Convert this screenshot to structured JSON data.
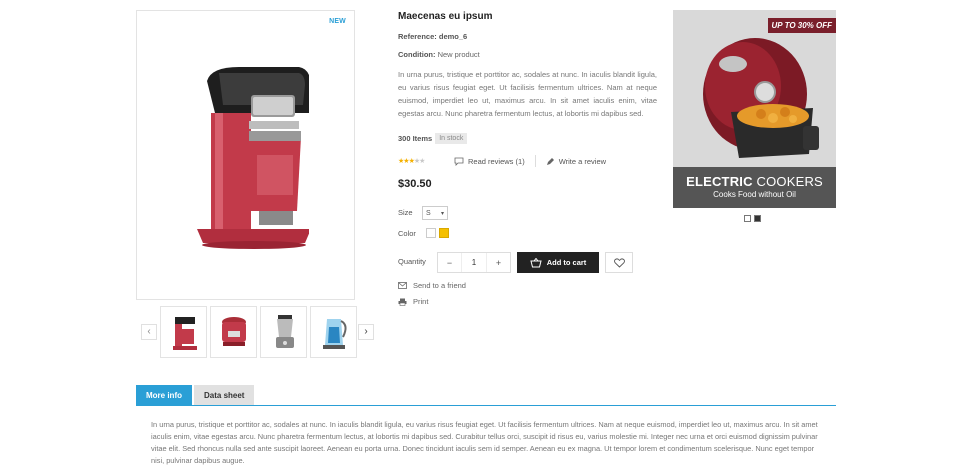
{
  "product": {
    "new_badge": "NEW",
    "name": "Maecenas eu ipsum",
    "reference_label": "Reference:",
    "reference_value": "demo_6",
    "condition_label": "Condition:",
    "condition_value": "New product",
    "description": "In urna purus, tristique et porttitor ac, sodales at nunc. In iaculis blandit ligula, eu varius risus feugiat eget. Ut facilisis fermentum ultrices. Nam at neque euismod, imperdiet leo ut, maximus arcu. In sit amet iaculis enim, vitae egestas arcu. Nunc pharetra fermentum lectus, at lobortis mi dapibus sed.",
    "items_count": "300 Items",
    "stock_status": "In stock",
    "rating": 3,
    "rating_max": 5,
    "reviews_link": "Read reviews (1)",
    "write_review_link": "Write a review",
    "price": "$30.50",
    "size_label": "Size",
    "size_value": "S",
    "color_label": "Color",
    "colors": [
      "#ffffff",
      "#f5c000"
    ],
    "quantity_label": "Quantity",
    "quantity_value": "1",
    "minus": "−",
    "plus": "+",
    "add_to_cart": "Add to cart",
    "send_to_friend": "Send to a friend",
    "print": "Print"
  },
  "thumbnails": {
    "items": [
      "coffee-maker",
      "rice-cooker",
      "blender",
      "kettle"
    ],
    "prev_icon": "chevron-left-icon",
    "next_icon": "chevron-right-icon"
  },
  "banner": {
    "badge": "UP TO 30% OFF",
    "title_bold": "ELECTRIC",
    "title_light": "COOKERS",
    "subtitle": "Cooks Food without Oil",
    "dots_active_index": 1
  },
  "tabs": {
    "items": [
      "More info",
      "Data sheet"
    ],
    "active": 0,
    "content": "In urna purus, tristique et porttitor ac, sodales at nunc. In iaculis blandit ligula, eu varius risus feugiat eget. Ut facilisis fermentum ultrices. Nam at neque euismod, imperdiet leo ut, maximus arcu. In sit amet iaculis enim, vitae egestas arcu. Nunc pharetra fermentum lectus, at lobortis mi dapibus sed. Curabitur tellus orci, suscipit id risus eu, varius molestie mi. Integer nec urna et orci euismod dignissim pulvinar vitae elit. Sed rhoncus nulla sed ante suscipit laoreet. Aenean eu porta urna. Donec tincidunt iaculis sem id semper. Aenean eu ex magna. Ut tempor lorem et condimentum scelerisque. Nunc eget tempor nisi, pulvinar dapibus augue."
  },
  "colors": {
    "accent": "#2a9fd6",
    "cart_button": "#222222",
    "banner_badge": "#7a1f2b",
    "stars": "#f5b100"
  }
}
